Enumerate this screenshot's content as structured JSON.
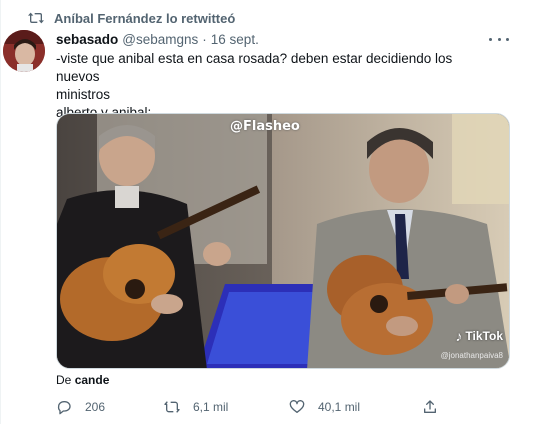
{
  "retweet_banner": {
    "text": "Aníbal Fernández lo retwitteó",
    "icon": "retweet-icon"
  },
  "tweet": {
    "author_name": "sebasado",
    "author_handle": "@sebamgns",
    "separator": "·",
    "date": "16 sept.",
    "text_lines": [
      "-viste que anibal esta en casa rosada? deben estar decidiendo los nuevos",
      "ministros",
      "alberto y anibal:"
    ],
    "media": {
      "watermark": "@Flasheo",
      "tiktok_label": "TikTok",
      "tiktok_user": "@jonathanpaiva8"
    },
    "source_prefix": "De",
    "source_name": "cande"
  },
  "actions": {
    "replies": "206",
    "retweets": "6,1 mil",
    "likes": "40,1 mil"
  },
  "colors": {
    "secondary_text": "#536471",
    "primary_text": "#0f1419",
    "border": "#cfd9de"
  }
}
